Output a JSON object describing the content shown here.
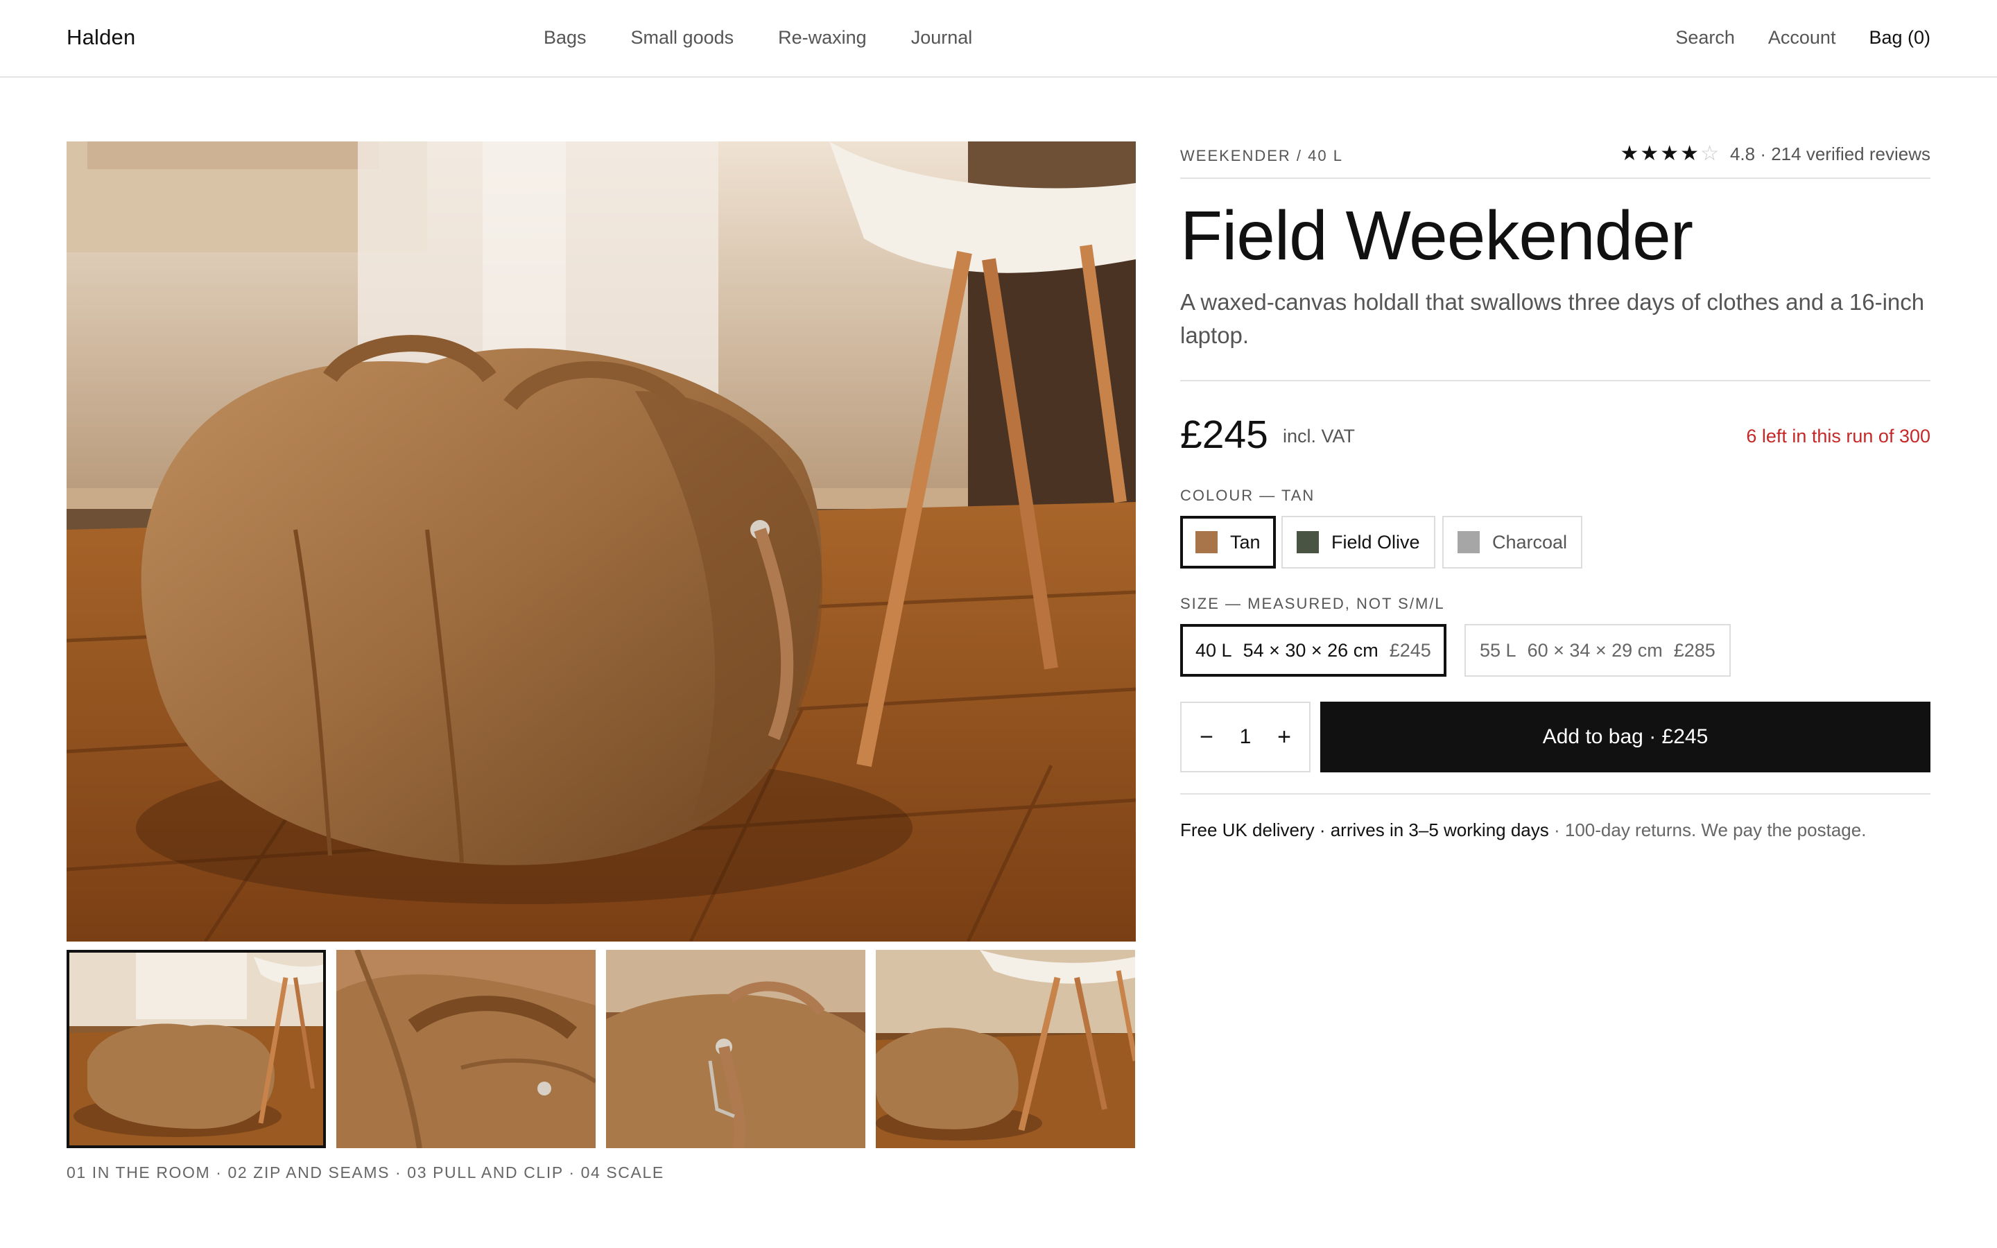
{
  "header": {
    "logo": "Halden",
    "nav": [
      "Bags",
      "Small goods",
      "Re-waxing",
      "Journal"
    ],
    "utility": {
      "search": "Search",
      "account": "Account",
      "bag": "Bag (0)"
    }
  },
  "gallery": {
    "selected_index": 0,
    "caption": "01 IN THE ROOM · 02 ZIP AND SEAMS · 03 PULL AND CLIP · 04 SCALE"
  },
  "product": {
    "eyebrow": "WEEKENDER / 40 L",
    "rating": {
      "stars": 4,
      "out_of": 5,
      "text": "4.8 · 214 verified reviews"
    },
    "title": "Field Weekender",
    "description": "A waxed-canvas holdall that swallows three days of clothes and a 16-inch laptop.",
    "price": "£245",
    "price_note": "incl. VAT",
    "stock_note": "6 left in this run of 300",
    "colour_label": "COLOUR — TAN",
    "colours": [
      {
        "name": "Tan",
        "swatch": "#a8754a",
        "selected": true
      },
      {
        "name": "Field Olive",
        "swatch": "#4a5443",
        "selected": false
      },
      {
        "name": "Charcoal",
        "swatch": "#a6a6a6",
        "selected": false
      }
    ],
    "size_label": "SIZE — MEASURED, NOT S/M/L",
    "sizes": [
      {
        "capacity": "40 L",
        "dims": "54 × 30 × 26 cm",
        "price": "£245",
        "selected": true
      },
      {
        "capacity": "55 L",
        "dims": "60 × 34 × 29 cm",
        "price": "£285",
        "selected": false
      }
    ],
    "quantity": {
      "minus": "−",
      "value": "1",
      "plus": "+"
    },
    "add_to_bag": "Add to bag · £245",
    "delivery": {
      "primary": "Free UK delivery · arrives in 3–5 working days",
      "secondary": " · 100-day returns. We pay the postage."
    }
  }
}
